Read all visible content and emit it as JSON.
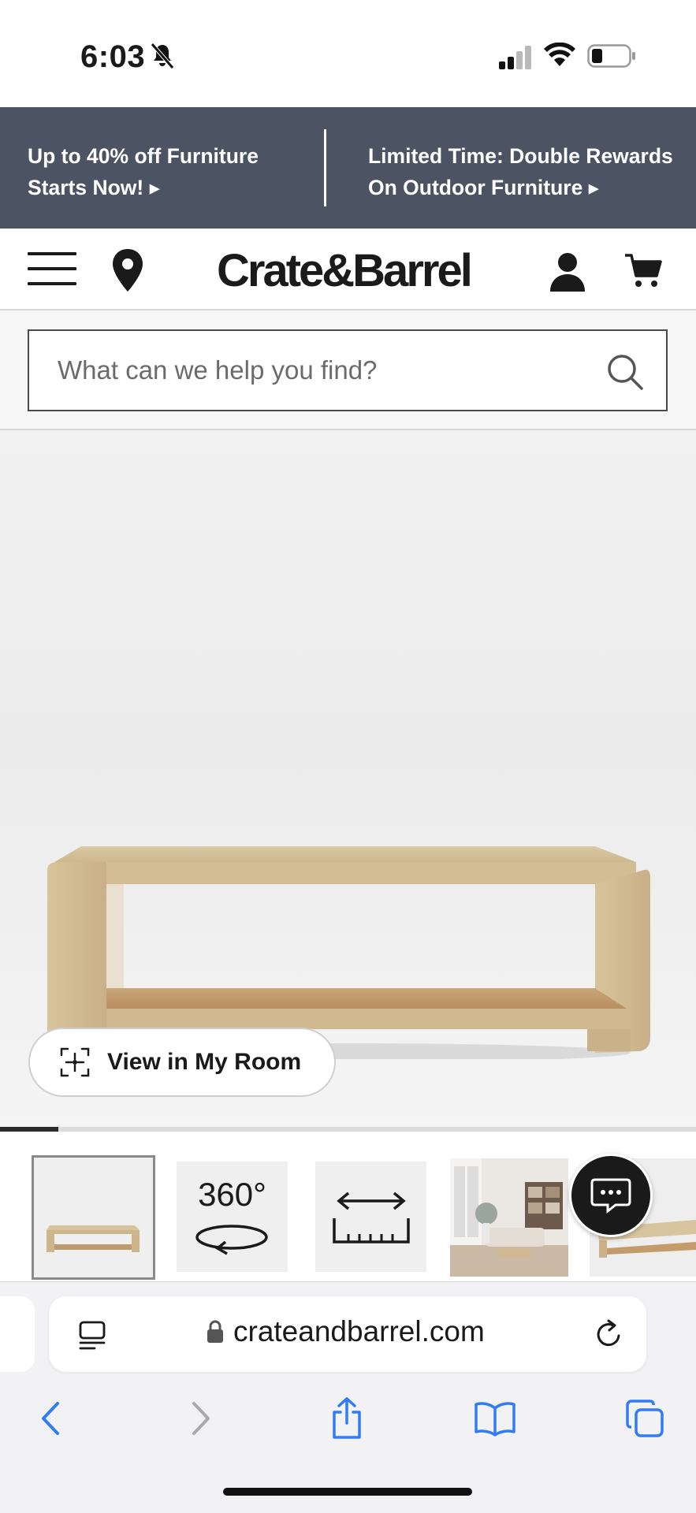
{
  "status_bar": {
    "time": "6:03",
    "icons": [
      "bell-slash-icon",
      "cellular-signal-icon",
      "wifi-icon",
      "battery-icon"
    ]
  },
  "promo": {
    "item1_line1": "Up to 40% off Furniture",
    "item1_line2": "Starts Now! ▸",
    "item2_line1": "Limited Time: Double Rewards",
    "item2_line2": "On Outdoor Furniture ▸"
  },
  "header": {
    "logo": "Crate&Barrel",
    "icons": [
      "menu-icon",
      "location-pin-icon",
      "account-icon",
      "cart-icon"
    ]
  },
  "search": {
    "placeholder": "What can we help you find?"
  },
  "hero": {
    "view_in_room_label": "View in My Room",
    "image_index": 1,
    "image_count": 12
  },
  "thumbnails": {
    "items": [
      "product-front",
      "360-view",
      "dimensions",
      "room-scene",
      "product-angle"
    ],
    "label_360": "360°"
  },
  "browser": {
    "url": "crateandbarrel.com"
  },
  "colors": {
    "promo_bg": "#4c5362",
    "text_dark": "#1a1a1a",
    "safari_blue": "#2f7cf6"
  }
}
